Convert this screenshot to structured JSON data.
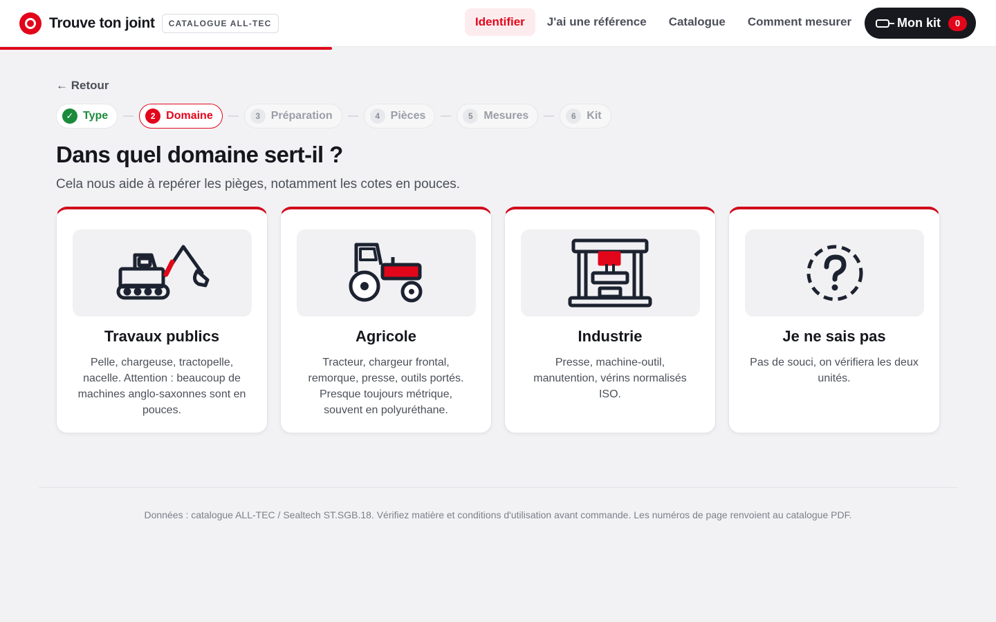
{
  "header": {
    "brand_title": "Trouve ton joint",
    "brand_badge": "CATALOGUE ALL-TEC",
    "nav": [
      {
        "label": "Identifier",
        "active": true
      },
      {
        "label": "J'ai une référence"
      },
      {
        "label": "Catalogue"
      },
      {
        "label": "Comment mesurer"
      }
    ],
    "kit": {
      "label": "Mon kit",
      "count": "0",
      "icon": "seal-icon"
    },
    "accent_color": "#e2061b",
    "progress_fraction": 0.333
  },
  "main": {
    "back_label": "← Retour",
    "steps": [
      {
        "num": "✓",
        "label": "Type",
        "state": "done"
      },
      {
        "num": "2",
        "label": "Domaine",
        "state": "current"
      },
      {
        "num": "3",
        "label": "Préparation",
        "state": "todo"
      },
      {
        "num": "4",
        "label": "Pièces",
        "state": "todo"
      },
      {
        "num": "5",
        "label": "Mesures",
        "state": "todo"
      },
      {
        "num": "6",
        "label": "Kit",
        "state": "todo"
      }
    ],
    "title": "Dans quel domaine sert-il ?",
    "subtitle": "Cela nous aide à repérer les pièges, notamment les cotes en pouces.",
    "cards": [
      {
        "icon": "excavator-icon",
        "title": "Travaux publics",
        "desc": "Pelle, chargeuse, tractopelle, nacelle. Attention : beaucoup de machines anglo-saxonnes sont en pouces."
      },
      {
        "icon": "tractor-icon",
        "title": "Agricole",
        "desc": "Tracteur, chargeur frontal, remorque, presse, outils portés. Presque toujours métrique, souvent en polyuréthane."
      },
      {
        "icon": "press-icon",
        "title": "Industrie",
        "desc": "Presse, machine-outil, manutention, vérins normalisés ISO."
      },
      {
        "icon": "question-icon",
        "title": "Je ne sais pas",
        "desc": "Pas de souci, on vérifiera les deux unités."
      }
    ]
  },
  "footer": {
    "text": "Données : catalogue ALL-TEC / Sealtech ST.SGB.18. Vérifiez matière et conditions d'utilisation avant commande. Les numéros de page renvoient au catalogue PDF."
  }
}
